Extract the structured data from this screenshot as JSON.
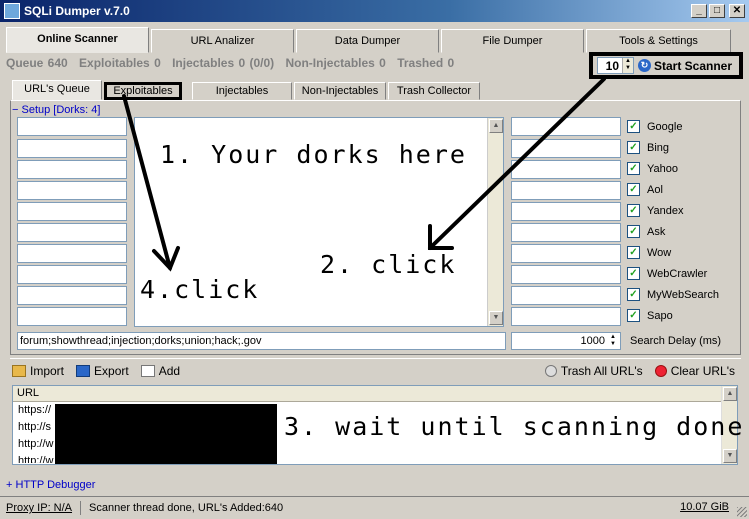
{
  "window": {
    "title": "SQLi Dumper v.7.0"
  },
  "top_tabs": [
    {
      "label": "Online Scanner"
    },
    {
      "label": "URL Analizer"
    },
    {
      "label": "Data Dumper"
    },
    {
      "label": "File Dumper"
    },
    {
      "label": "Tools & Settings"
    }
  ],
  "stats": {
    "queue": "Queue 640",
    "exploitables": "Exploitables 0",
    "injectables": "Injectables 0 (0/0)",
    "non_injectables": "Non-Injectables 0",
    "trashed": "Trashed 0"
  },
  "scanner": {
    "threads": "10",
    "start_label": "Start Scanner"
  },
  "sub_tabs": [
    {
      "label": "URL's Queue"
    },
    {
      "label": "Exploitables"
    },
    {
      "label": "Injectables"
    },
    {
      "label": "Non-Injectables"
    },
    {
      "label": "Trash Collector"
    }
  ],
  "setup": {
    "label": "Setup [Dorks: 4]"
  },
  "search_engines": [
    {
      "label": "Google",
      "checked": true
    },
    {
      "label": "Bing",
      "checked": true
    },
    {
      "label": "Yahoo",
      "checked": true
    },
    {
      "label": "Aol",
      "checked": true
    },
    {
      "label": "Yandex",
      "checked": true
    },
    {
      "label": "Ask",
      "checked": true
    },
    {
      "label": "Wow",
      "checked": true
    },
    {
      "label": "WebCrawler",
      "checked": true
    },
    {
      "label": "MyWebSearch",
      "checked": true
    },
    {
      "label": "Sapo",
      "checked": true
    }
  ],
  "check_glyph": "✓",
  "dorks_input": "forum;showthread;injection;dorks;union;hack;.gov",
  "delay": {
    "value": "1000",
    "label": "Search Delay (ms)"
  },
  "toolbar": {
    "import": "Import",
    "export": "Export",
    "add": "Add",
    "trash_all": "Trash All URL's",
    "clear": "Clear URL's"
  },
  "url_list": {
    "header": "URL",
    "rows": [
      "https://",
      "http://s",
      "http://w",
      "http://w"
    ]
  },
  "annotations": {
    "step1": "1. Your dorks here",
    "step2": "2. click",
    "step3": "3. wait until scanning done",
    "step4": "4.click"
  },
  "http_debugger": "HTTP Debugger",
  "status": {
    "proxy": "Proxy IP: N/A",
    "message": "Scanner thread done, URL's Added:640",
    "disk": "10.07 GiB"
  },
  "icons": {
    "minimize": "_",
    "maximize": "□",
    "close": "✕",
    "spin_up": "▲",
    "spin_down": "▼",
    "start": "↻",
    "expand": "+",
    "collapse": "−"
  }
}
